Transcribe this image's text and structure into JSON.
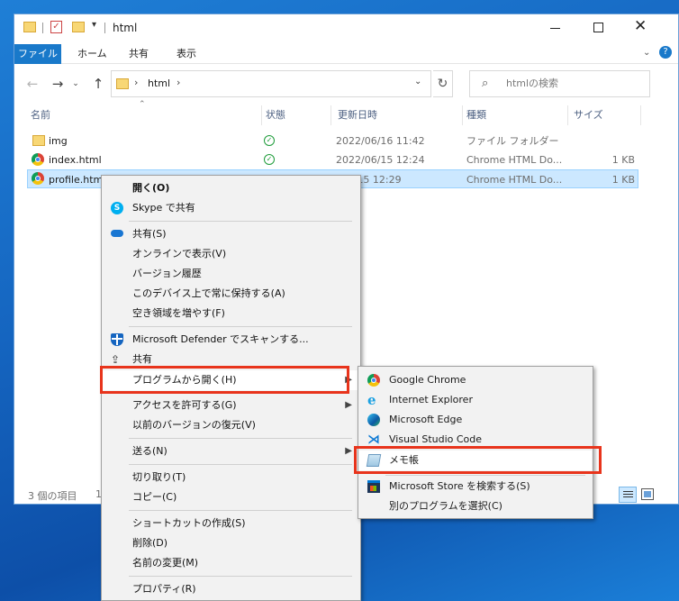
{
  "window": {
    "title": "html",
    "ribbon_tabs": [
      "ファイル",
      "ホーム",
      "共有",
      "表示"
    ],
    "address": "html",
    "search_placeholder": "htmlの検索",
    "columns": [
      "名前",
      "状態",
      "更新日時",
      "種類",
      "サイズ"
    ],
    "files": [
      {
        "name": "img",
        "date": "2022/06/16 11:42",
        "type": "ファイル フォルダー",
        "size": ""
      },
      {
        "name": "index.html",
        "date": "2022/06/15 12:24",
        "type": "Chrome HTML Do...",
        "size": "1 KB"
      },
      {
        "name": "profile.html",
        "date": "2022/06/15 12:29",
        "type": "Chrome HTML Do...",
        "size": "1 KB"
      }
    ],
    "status_count": "3 個の項目",
    "status_partial": "1"
  },
  "context_menu": {
    "open": "開く(O)",
    "skype": "Skype で共有",
    "share_onedrive": "共有(S)",
    "view_online": "オンラインで表示(V)",
    "version_history": "バージョン履歴",
    "keep_on_device": "このデバイス上で常に保持する(A)",
    "free_space": "空き領域を増やす(F)",
    "defender": "Microsoft Defender でスキャンする...",
    "share": "共有",
    "open_with": "プログラムから開く(H)",
    "give_access": "アクセスを許可する(G)",
    "restore_versions": "以前のバージョンの復元(V)",
    "send_to": "送る(N)",
    "cut": "切り取り(T)",
    "copy": "コピー(C)",
    "create_shortcut": "ショートカットの作成(S)",
    "delete": "削除(D)",
    "rename": "名前の変更(M)",
    "properties": "プロパティ(R)"
  },
  "submenu": {
    "chrome": "Google Chrome",
    "ie": "Internet Explorer",
    "edge": "Microsoft Edge",
    "vscode": "Visual Studio Code",
    "notepad": "メモ帳",
    "store": "Microsoft Store を検索する(S)",
    "other": "別のプログラムを選択(C)"
  },
  "colors": {
    "accent": "#1979ca",
    "highlight": "#e8341c",
    "selection": "#cce8ff"
  }
}
